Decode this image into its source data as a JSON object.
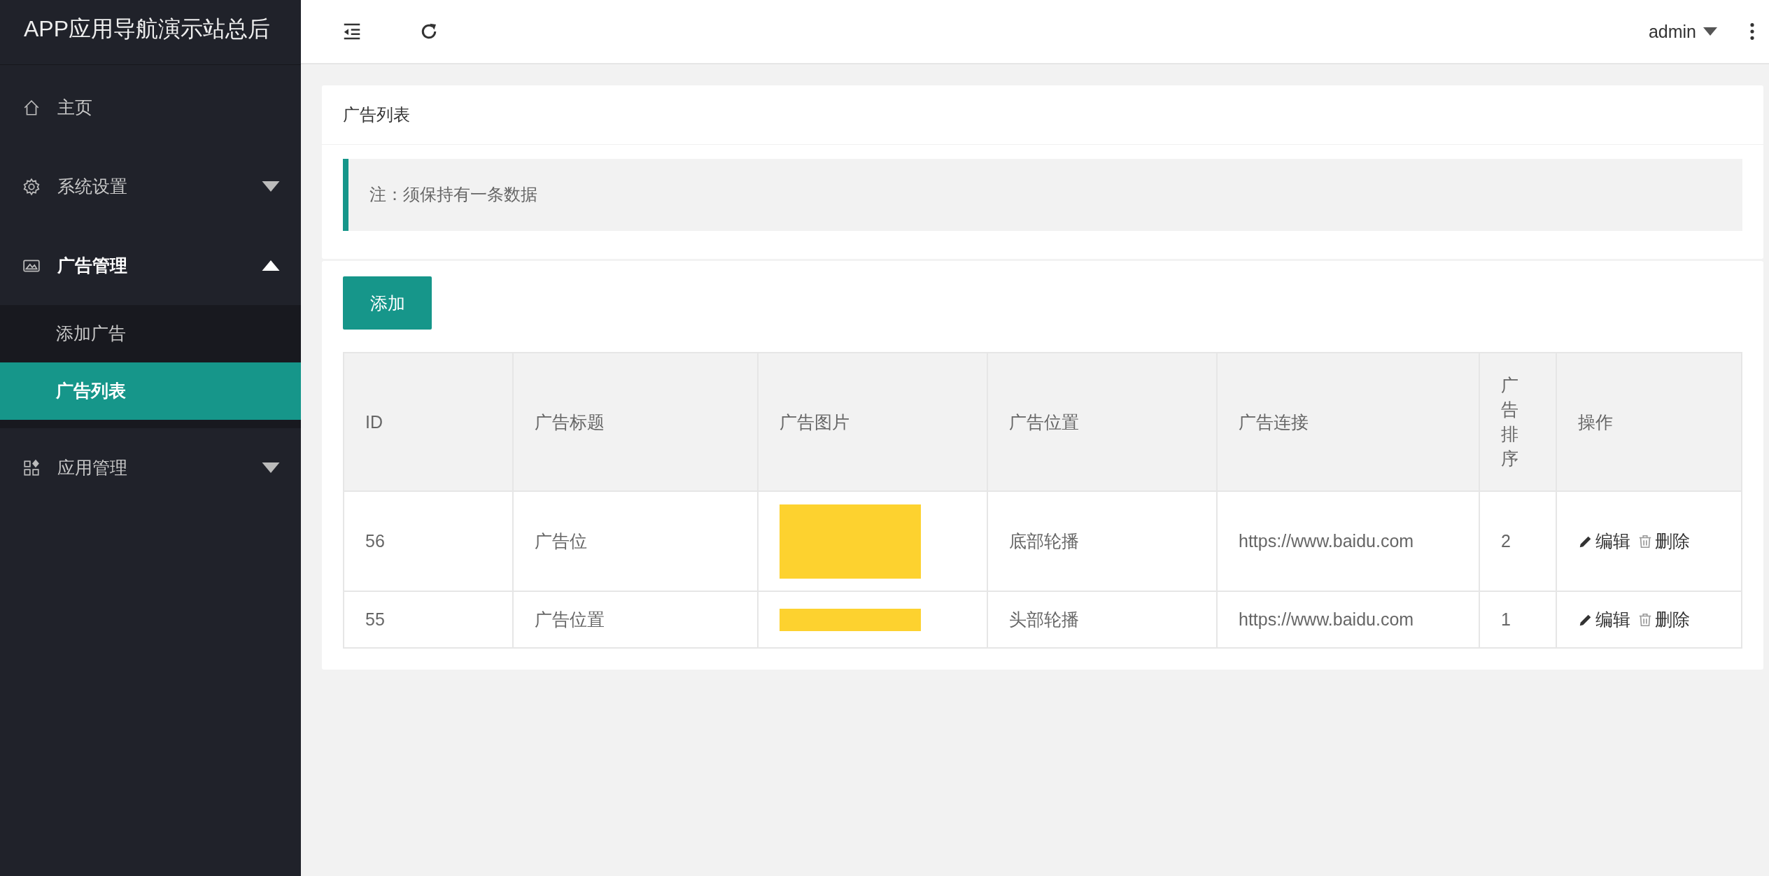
{
  "sidebar": {
    "title": "APP应用导航演示站总后",
    "items": [
      {
        "label": "主页",
        "has_children": false,
        "expanded": false
      },
      {
        "label": "系统设置",
        "has_children": true,
        "expanded": false
      },
      {
        "label": "广告管理",
        "has_children": true,
        "expanded": true,
        "children": [
          {
            "label": "添加广告",
            "selected": false
          },
          {
            "label": "广告列表",
            "selected": true
          }
        ]
      },
      {
        "label": "应用管理",
        "has_children": true,
        "expanded": false
      }
    ]
  },
  "header": {
    "user": "admin"
  },
  "card": {
    "title": "广告列表",
    "note": "注：须保持有一条数据"
  },
  "add_button": "添加",
  "table": {
    "columns": [
      "ID",
      "广告标题",
      "广告图片",
      "广告位置",
      "广告连接",
      "广告排序",
      "操作"
    ],
    "rows": [
      {
        "id": "56",
        "title": "广告位",
        "position": "底部轮播",
        "link": "https://www.baidu.com",
        "order": "2",
        "edit": "编辑",
        "delete": "删除"
      },
      {
        "id": "55",
        "title": "广告位置",
        "position": "头部轮播",
        "link": "https://www.baidu.com",
        "order": "1",
        "edit": "编辑",
        "delete": "删除"
      }
    ]
  }
}
